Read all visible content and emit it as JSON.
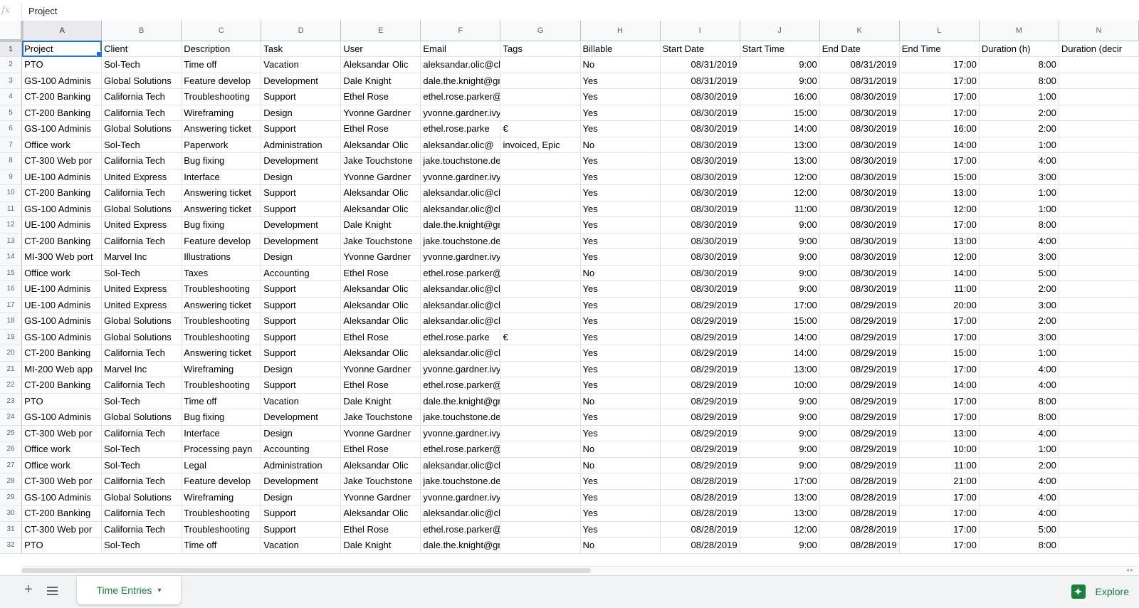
{
  "formula_bar": {
    "fx": "fx",
    "value": "Project"
  },
  "columns": [
    "A",
    "B",
    "C",
    "D",
    "E",
    "F",
    "G",
    "H",
    "I",
    "J",
    "K",
    "L",
    "M",
    "N"
  ],
  "selected_column": "A",
  "header_row": [
    "Project",
    "Client",
    "Description",
    "Task",
    "User",
    "Email",
    "Tags",
    "Billable",
    "Start Date",
    "Start Time",
    "End Date",
    "End Time",
    "Duration (h)",
    "Duration (decir"
  ],
  "rows": [
    [
      "PTO",
      "Sol-Tech",
      "Time off",
      "Vacation",
      "Aleksandar Olic",
      "aleksandar.olic@clockify.me",
      "",
      "No",
      "08/31/2019",
      "9:00",
      "08/31/2019",
      "17:00",
      "8:00",
      ""
    ],
    [
      "GS-100 Adminis",
      "Global Solutions",
      "Feature develop",
      "Development",
      "Dale Knight",
      "dale.the.knight@gmail.com",
      "",
      "Yes",
      "08/31/2019",
      "9:00",
      "08/31/2019",
      "17:00",
      "8:00",
      ""
    ],
    [
      "CT-200 Banking",
      "California Tech",
      "Troubleshooting",
      "Support",
      "Ethel Rose",
      "ethel.rose.parker@gmail.com",
      "",
      "Yes",
      "08/30/2019",
      "16:00",
      "08/30/2019",
      "17:00",
      "1:00",
      ""
    ],
    [
      "CT-200 Banking",
      "California Tech",
      "Wireframing",
      "Design",
      "Yvonne Gardner",
      "yvonne.gardner.ivy@gmail.com",
      "",
      "Yes",
      "08/30/2019",
      "15:00",
      "08/30/2019",
      "17:00",
      "2:00",
      ""
    ],
    [
      "GS-100 Adminis",
      "Global Solutions",
      "Answering ticket",
      "Support",
      "Ethel Rose",
      "ethel.rose.parke",
      "€",
      "Yes",
      "08/30/2019",
      "14:00",
      "08/30/2019",
      "16:00",
      "2:00",
      ""
    ],
    [
      "Office work",
      "Sol-Tech",
      "Paperwork",
      "Administration",
      "Aleksandar Olic",
      "aleksandar.olic@",
      "invoiced, Epic",
      "No",
      "08/30/2019",
      "13:00",
      "08/30/2019",
      "14:00",
      "1:00",
      ""
    ],
    [
      "CT-300 Web por",
      "California Tech",
      "Bug fixing",
      "Development",
      "Jake Touchstone",
      "jake.touchstone.dev@gmail.com",
      "",
      "Yes",
      "08/30/2019",
      "13:00",
      "08/30/2019",
      "17:00",
      "4:00",
      ""
    ],
    [
      "UE-100 Adminis",
      "United Express",
      "Interface",
      "Design",
      "Yvonne Gardner",
      "yvonne.gardner.ivy@gmail.com",
      "",
      "Yes",
      "08/30/2019",
      "12:00",
      "08/30/2019",
      "15:00",
      "3:00",
      ""
    ],
    [
      "CT-200 Banking",
      "California Tech",
      "Answering ticket",
      "Support",
      "Aleksandar Olic",
      "aleksandar.olic@clockify.me",
      "",
      "Yes",
      "08/30/2019",
      "12:00",
      "08/30/2019",
      "13:00",
      "1:00",
      ""
    ],
    [
      "GS-100 Adminis",
      "Global Solutions",
      "Answering ticket",
      "Support",
      "Aleksandar Olic",
      "aleksandar.olic@clockify.me",
      "",
      "Yes",
      "08/30/2019",
      "11:00",
      "08/30/2019",
      "12:00",
      "1:00",
      ""
    ],
    [
      "UE-100 Adminis",
      "United Express",
      "Bug fixing",
      "Development",
      "Dale Knight",
      "dale.the.knight@gmail.com",
      "",
      "Yes",
      "08/30/2019",
      "9:00",
      "08/30/2019",
      "17:00",
      "8:00",
      ""
    ],
    [
      "CT-200 Banking",
      "California Tech",
      "Feature develop",
      "Development",
      "Jake Touchstone",
      "jake.touchstone.dev@gmail.com",
      "",
      "Yes",
      "08/30/2019",
      "9:00",
      "08/30/2019",
      "13:00",
      "4:00",
      ""
    ],
    [
      "MI-300 Web port",
      "Marvel Inc",
      "Illustrations",
      "Design",
      "Yvonne Gardner",
      "yvonne.gardner.ivy@gmail.com",
      "",
      "Yes",
      "08/30/2019",
      "9:00",
      "08/30/2019",
      "12:00",
      "3:00",
      ""
    ],
    [
      "Office work",
      "Sol-Tech",
      "Taxes",
      "Accounting",
      "Ethel Rose",
      "ethel.rose.parker@gmail.com",
      "",
      "No",
      "08/30/2019",
      "9:00",
      "08/30/2019",
      "14:00",
      "5:00",
      ""
    ],
    [
      "UE-100 Adminis",
      "United Express",
      "Troubleshooting",
      "Support",
      "Aleksandar Olic",
      "aleksandar.olic@clockify.me",
      "",
      "Yes",
      "08/30/2019",
      "9:00",
      "08/30/2019",
      "11:00",
      "2:00",
      ""
    ],
    [
      "UE-100 Adminis",
      "United Express",
      "Answering ticket",
      "Support",
      "Aleksandar Olic",
      "aleksandar.olic@clockify.me",
      "",
      "Yes",
      "08/29/2019",
      "17:00",
      "08/29/2019",
      "20:00",
      "3:00",
      ""
    ],
    [
      "GS-100 Adminis",
      "Global Solutions",
      "Troubleshooting",
      "Support",
      "Aleksandar Olic",
      "aleksandar.olic@clockify.me",
      "",
      "Yes",
      "08/29/2019",
      "15:00",
      "08/29/2019",
      "17:00",
      "2:00",
      ""
    ],
    [
      "GS-100 Adminis",
      "Global Solutions",
      "Troubleshooting",
      "Support",
      "Ethel Rose",
      "ethel.rose.parke",
      "€",
      "Yes",
      "08/29/2019",
      "14:00",
      "08/29/2019",
      "17:00",
      "3:00",
      ""
    ],
    [
      "CT-200 Banking",
      "California Tech",
      "Answering ticket",
      "Support",
      "Aleksandar Olic",
      "aleksandar.olic@clockify.me",
      "",
      "Yes",
      "08/29/2019",
      "14:00",
      "08/29/2019",
      "15:00",
      "1:00",
      ""
    ],
    [
      "MI-200 Web app",
      "Marvel Inc",
      "Wireframing",
      "Design",
      "Yvonne Gardner",
      "yvonne.gardner.ivy@gmail.com",
      "",
      "Yes",
      "08/29/2019",
      "13:00",
      "08/29/2019",
      "17:00",
      "4:00",
      ""
    ],
    [
      "CT-200 Banking",
      "California Tech",
      "Troubleshooting",
      "Support",
      "Ethel Rose",
      "ethel.rose.parker@gmail.com",
      "",
      "Yes",
      "08/29/2019",
      "10:00",
      "08/29/2019",
      "14:00",
      "4:00",
      ""
    ],
    [
      "PTO",
      "Sol-Tech",
      "Time off",
      "Vacation",
      "Dale Knight",
      "dale.the.knight@gmail.com",
      "",
      "No",
      "08/29/2019",
      "9:00",
      "08/29/2019",
      "17:00",
      "8:00",
      ""
    ],
    [
      "GS-100 Adminis",
      "Global Solutions",
      "Bug fixing",
      "Development",
      "Jake Touchstone",
      "jake.touchstone.dev@gmail.com",
      "",
      "Yes",
      "08/29/2019",
      "9:00",
      "08/29/2019",
      "17:00",
      "8:00",
      ""
    ],
    [
      "CT-300 Web por",
      "California Tech",
      "Interface",
      "Design",
      "Yvonne Gardner",
      "yvonne.gardner.ivy@gmail.com",
      "",
      "Yes",
      "08/29/2019",
      "9:00",
      "08/29/2019",
      "13:00",
      "4:00",
      ""
    ],
    [
      "Office work",
      "Sol-Tech",
      "Processing payn",
      "Accounting",
      "Ethel Rose",
      "ethel.rose.parker@gmail.com",
      "",
      "No",
      "08/29/2019",
      "9:00",
      "08/29/2019",
      "10:00",
      "1:00",
      ""
    ],
    [
      "Office work",
      "Sol-Tech",
      "Legal",
      "Administration",
      "Aleksandar Olic",
      "aleksandar.olic@clockify.me",
      "",
      "No",
      "08/29/2019",
      "9:00",
      "08/29/2019",
      "11:00",
      "2:00",
      ""
    ],
    [
      "CT-300 Web por",
      "California Tech",
      "Feature develop",
      "Development",
      "Jake Touchstone",
      "jake.touchstone.dev@gmail.com",
      "",
      "Yes",
      "08/28/2019",
      "17:00",
      "08/28/2019",
      "21:00",
      "4:00",
      ""
    ],
    [
      "GS-100 Adminis",
      "Global Solutions",
      "Wireframing",
      "Design",
      "Yvonne Gardner",
      "yvonne.gardner.ivy@gmail.com",
      "",
      "Yes",
      "08/28/2019",
      "13:00",
      "08/28/2019",
      "17:00",
      "4:00",
      ""
    ],
    [
      "CT-200 Banking",
      "California Tech",
      "Troubleshooting",
      "Support",
      "Aleksandar Olic",
      "aleksandar.olic@clockify.me",
      "",
      "Yes",
      "08/28/2019",
      "13:00",
      "08/28/2019",
      "17:00",
      "4:00",
      ""
    ],
    [
      "CT-300 Web por",
      "California Tech",
      "Troubleshooting",
      "Support",
      "Ethel Rose",
      "ethel.rose.parker@gmail.com",
      "",
      "Yes",
      "08/28/2019",
      "12:00",
      "08/28/2019",
      "17:00",
      "5:00",
      ""
    ],
    [
      "PTO",
      "Sol-Tech",
      "Time off",
      "Vacation",
      "Dale Knight",
      "dale.the.knight@gmail.com",
      "",
      "No",
      "08/28/2019",
      "9:00",
      "08/28/2019",
      "17:00",
      "8:00",
      ""
    ]
  ],
  "numeric_columns": [
    8,
    9,
    10,
    11,
    12
  ],
  "sheet_bar": {
    "add_sheet": "+",
    "tab_name": "Time Entries",
    "tab_caret": "▾",
    "explore_label": "Explore",
    "explore_icon": "✦"
  },
  "colors": {
    "accent": "#188038",
    "selection": "#1a73e8"
  }
}
